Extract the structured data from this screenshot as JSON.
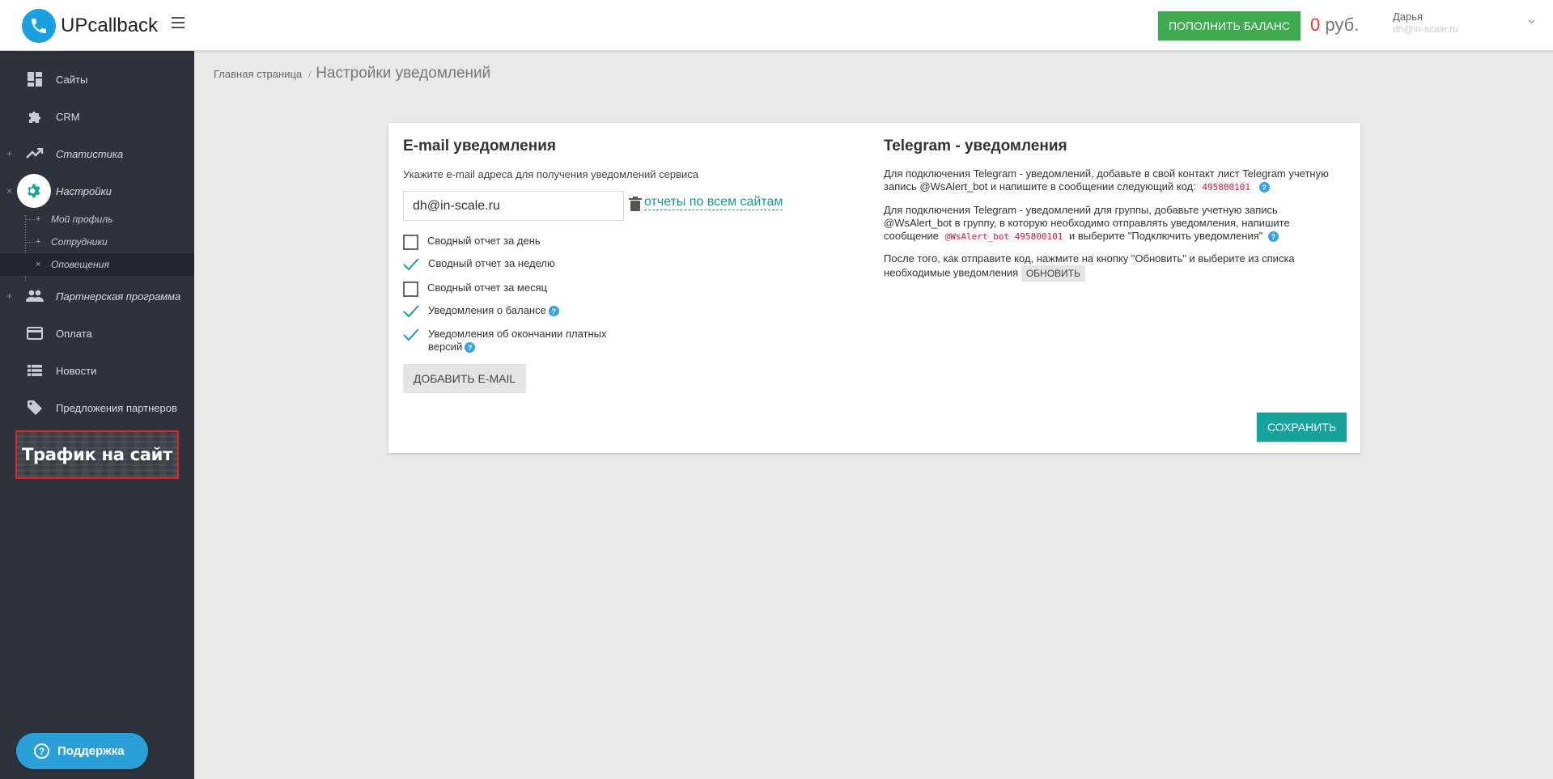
{
  "app": {
    "logo_text": "UPcallback"
  },
  "header": {
    "topup_label": "ПОПОЛНИТЬ БАЛАНС",
    "balance_amount": "0",
    "balance_currency": "руб.",
    "user_name": "Дарья",
    "user_email": "dh@in-scale.ru"
  },
  "sidebar": {
    "items": [
      {
        "label": "Сайты",
        "icon": "dashboard-icon"
      },
      {
        "label": "CRM",
        "icon": "puzzle-icon"
      },
      {
        "label": "Статистика",
        "icon": "trending-up-icon",
        "prefix": "+"
      },
      {
        "label": "Настройки",
        "icon": "gear-icon",
        "prefix": "×"
      },
      {
        "label": "Партнерская программа",
        "icon": "people-icon",
        "prefix": "+"
      },
      {
        "label": "Оплата",
        "icon": "credit-card-icon"
      },
      {
        "label": "Новости",
        "icon": "list-icon"
      },
      {
        "label": "Предложения партнеров",
        "icon": "tag-icon"
      }
    ],
    "subitems": [
      {
        "label": "Мой профиль",
        "mark": "+"
      },
      {
        "label": "Сотрудники",
        "mark": "+"
      },
      {
        "label": "Оповещения",
        "mark": "×"
      }
    ],
    "traffic_banner": "Трафик на сайт",
    "support_label": "Поддержка"
  },
  "breadcrumb": {
    "home": "Главная страница",
    "separator": "/",
    "current": "Настройки уведомлений"
  },
  "email_section": {
    "title": "E-mail уведомления",
    "hint": "Укажите e-mail адреса для получения уведомлений сервиса",
    "email_value": "dh@in-scale.ru",
    "all_sites_link": "отчеты по всем сайтам",
    "checkboxes": [
      {
        "label": "Сводный отчет за день",
        "checked": false
      },
      {
        "label": "Сводный отчет за неделю",
        "checked": true
      },
      {
        "label": "Сводный отчет за месяц",
        "checked": false
      },
      {
        "label": "Уведомления о балансе",
        "checked": true
      },
      {
        "label_line1": "Уведомления об окончании платных",
        "label_line2": "версий",
        "checked": true
      }
    ],
    "add_email_label": "ДОБАВИТЬ E-MAIL"
  },
  "telegram_section": {
    "title": "Telegram - уведомления",
    "para1_text": "Для подключения Telegram - уведомлений, добавьте в свой контакт лист Telegram учетную запись @WsAlert_bot и напишите в сообщении следующий код:",
    "para1_code": "495800101",
    "para2_text": "Для подключения Telegram - уведомлений для группы, добавьте учетную запись @WsAlert_bot в группу, в которую необходимо отправлять уведомления, напишите сообщение",
    "para2_code": "@WsAlert_bot 495800101",
    "para2_tail": "и выберите \"Подключить уведомления\"",
    "para3_text": "После того, как отправите код, нажмите на кнопку \"Обновить\" и выберите из списка необходимые уведомления",
    "refresh_label": "ОБНОВИТЬ"
  },
  "save_label": "СОХРАНИТЬ",
  "colors": {
    "sidebar_bg": "#2c333d",
    "accent_green": "#3faa4f",
    "accent_teal": "#17a39b",
    "balance_red": "#e63737",
    "support_blue": "#2a9fd8"
  }
}
